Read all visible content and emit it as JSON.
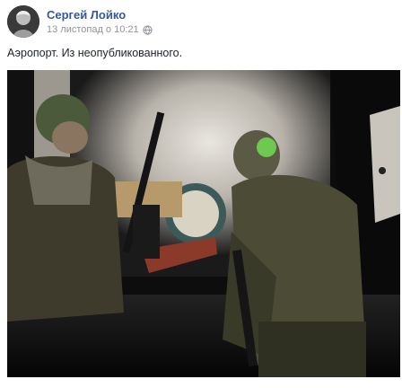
{
  "post": {
    "author": "Сергей Лойко",
    "timestamp": "13 листопад о 10:21",
    "privacy_icon": "globe-icon",
    "text": "Аэропорт. Из неопубликованного."
  },
  "photo": {
    "subject": "photo"
  }
}
